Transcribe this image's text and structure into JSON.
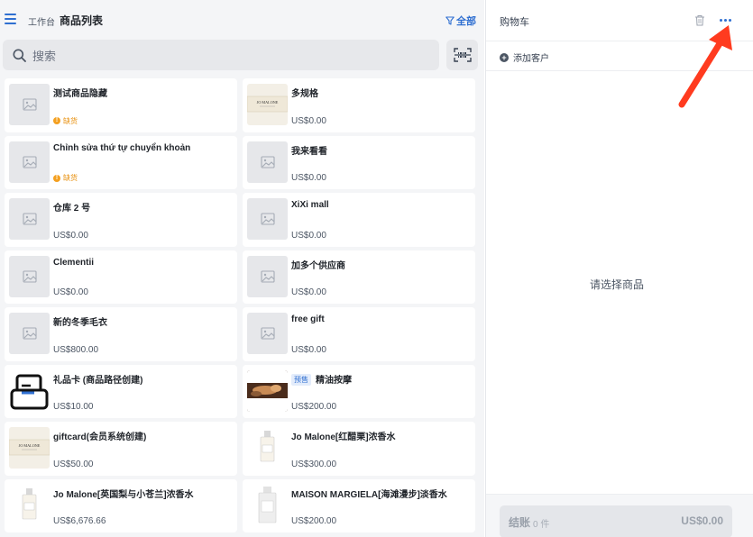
{
  "header": {
    "workbench": "工作台",
    "title": "商品列表",
    "filter_label": "全部"
  },
  "search": {
    "placeholder": "搜索"
  },
  "products": [
    {
      "name": "测试商品隐藏",
      "price": "",
      "stock": "缺货"
    },
    {
      "name": "多规格",
      "price": "US$0.00",
      "stock": ""
    },
    {
      "name": "Chỉnh sửa thứ tự chuyển khoản",
      "price": "",
      "stock": "缺货"
    },
    {
      "name": "我来看看",
      "price": "US$0.00",
      "stock": ""
    },
    {
      "name": "仓库 2 号",
      "price": "US$0.00",
      "stock": ""
    },
    {
      "name": "XiXi mall",
      "price": "US$0.00",
      "stock": ""
    },
    {
      "name": "Clementii",
      "price": "US$0.00",
      "stock": ""
    },
    {
      "name": "加多个供应商",
      "price": "US$0.00",
      "stock": ""
    },
    {
      "name": "新的冬季毛衣",
      "price": "US$800.00",
      "stock": ""
    },
    {
      "name": "free gift",
      "price": "US$0.00",
      "stock": ""
    },
    {
      "name": "礼品卡 (商品路径创建)",
      "price": "US$10.00",
      "stock": ""
    },
    {
      "name": "精油按摩",
      "price": "US$200.00",
      "stock": "",
      "badge": "预售"
    },
    {
      "name": "giftcard(会员系统创建)",
      "price": "US$50.00",
      "stock": ""
    },
    {
      "name": "Jo Malone[红醋栗]浓香水",
      "price": "US$300.00",
      "stock": ""
    },
    {
      "name": "Jo Malone[英国梨与小苍兰]浓香水",
      "price": "US$6,676.66",
      "stock": ""
    },
    {
      "name": "MAISON MARGIELA[海滩漫步]淡香水",
      "price": "US$200.00",
      "stock": ""
    }
  ],
  "cart": {
    "title": "购物车",
    "add_customer": "添加客户",
    "empty_hint": "请选择商品",
    "checkout_label": "结账",
    "checkout_count": "0 件",
    "checkout_total": "US$0.00"
  },
  "brand_logo_text": "JO MALONE",
  "colors": {
    "accent": "#2f6fd1",
    "warning": "#f4a020",
    "annotation_arrow": "#ff3b1f"
  }
}
